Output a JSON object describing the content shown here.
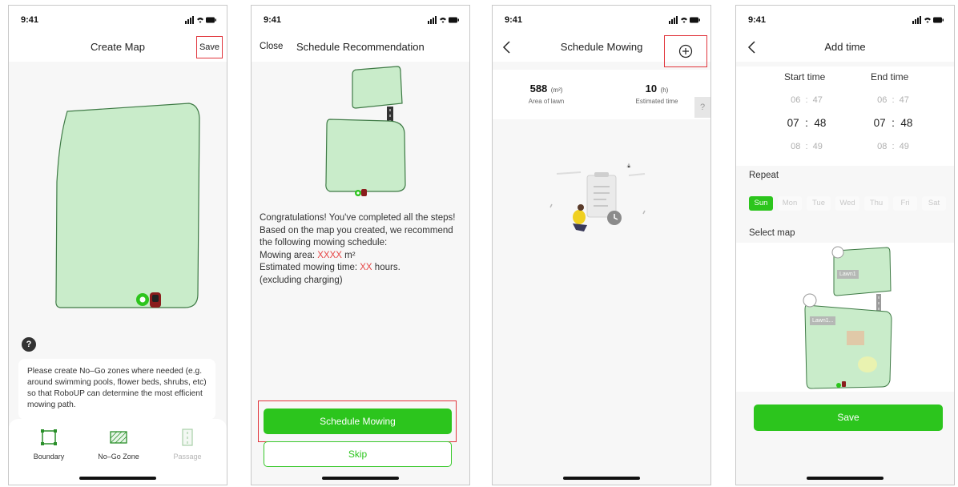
{
  "status": {
    "time": "9:41"
  },
  "screen1": {
    "title": "Create Map",
    "save_label": "Save",
    "help_symbol": "?",
    "info_text": "Please create No–Go zones where needed (e.g. around swimming pools, flower beds, shrubs, etc) so that  RoboUP can determine the most efficient mowing path.",
    "tools": [
      {
        "label": "Boundary",
        "icon": "boundary-icon"
      },
      {
        "label": "No–Go Zone",
        "icon": "no-go-zone-icon"
      },
      {
        "label": "Passage",
        "icon": "passage-icon",
        "disabled": true
      }
    ]
  },
  "screen2": {
    "close_label": "Close",
    "title": "Schedule Recommendation",
    "para_intro": "Congratulations! You've completed all the steps! Based on the map you created, we recommend the following mowing schedule:",
    "area_label": "Mowing area: ",
    "area_value": "XXXX",
    "area_unit": " m²",
    "time_label": "Estimated mowing time: ",
    "time_value": "XX",
    "time_unit": " hours.",
    "note": "(excluding charging)",
    "primary_button": "Schedule Mowing",
    "secondary_button": "Skip"
  },
  "screen3": {
    "title": "Schedule Mowing",
    "area_value": "588",
    "area_unit": "(m²)",
    "area_label": "Area of lawn",
    "time_value": "10",
    "time_unit": "(h)",
    "time_label": "Estimated  time",
    "help_symbol": "?"
  },
  "screen4": {
    "title": "Add time",
    "start_label": "Start time",
    "end_label": "End time",
    "start_rows": [
      [
        "06",
        "47"
      ],
      [
        "07",
        "48"
      ],
      [
        "08",
        "49"
      ]
    ],
    "end_rows": [
      [
        "06",
        "47"
      ],
      [
        "07",
        "48"
      ],
      [
        "08",
        "49"
      ]
    ],
    "separator": ":",
    "repeat_label": "Repeat",
    "days": [
      "Sun",
      "Mon",
      "Tue",
      "Wed",
      "Thu",
      "Fri",
      "Sat"
    ],
    "active_day": "Sun",
    "select_map_label": "Select map",
    "lawn_labels": [
      "Lawn1",
      "Lawn1..."
    ],
    "save_label": "Save"
  },
  "colors": {
    "accent": "#2cc51d",
    "lawn_fill": "#c9ecca",
    "lawn_stroke": "#3e7a45",
    "highlight": "#e1353c",
    "warning_text": "#e64545"
  }
}
